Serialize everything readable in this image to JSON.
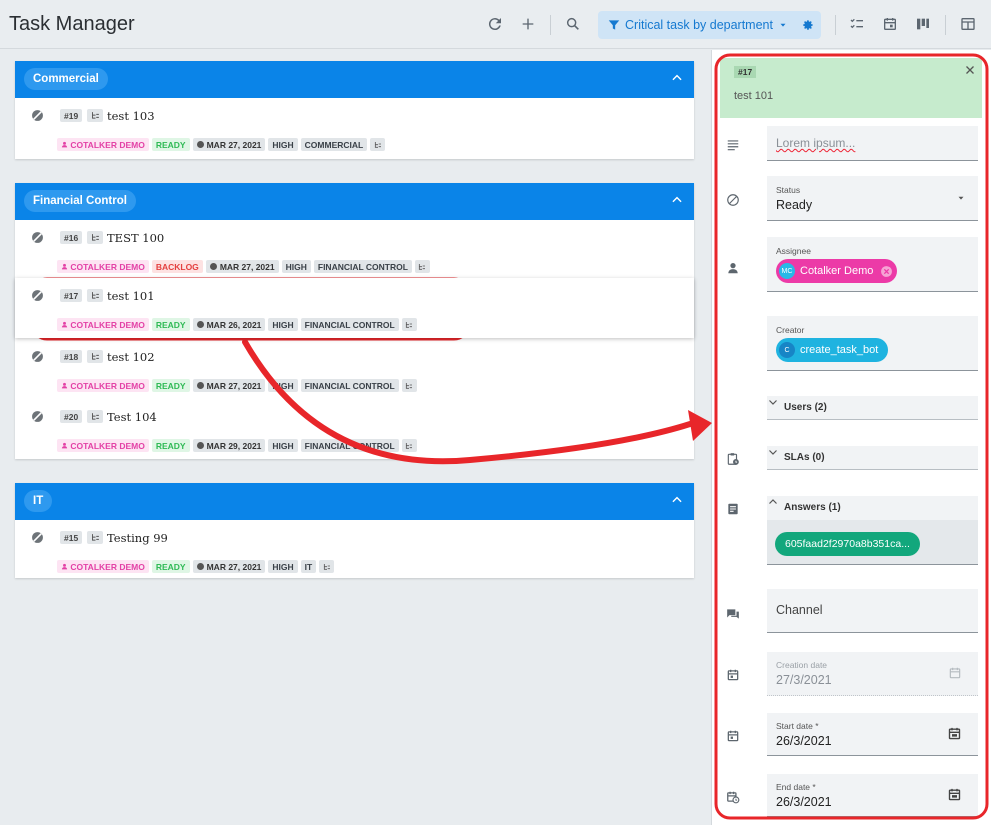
{
  "header": {
    "title": "Task Manager",
    "filter_label": "Critical task by department"
  },
  "groups": [
    {
      "name": "Commercial",
      "tasks": [
        {
          "id": "#19",
          "title": "test 103",
          "user": "COTALKER DEMO",
          "status": "READY",
          "date": "MAR 27, 2021",
          "priority": "HIGH",
          "dept": "COMMERCIAL"
        }
      ]
    },
    {
      "name": "Financial Control",
      "tasks": [
        {
          "id": "#16",
          "title": "TEST 100",
          "user": "COTALKER DEMO",
          "status": "BACKLOG",
          "date": "MAR 27, 2021",
          "priority": "HIGH",
          "dept": "FINANCIAL CONTROL"
        },
        {
          "id": "#17",
          "title": "test 101",
          "user": "COTALKER DEMO",
          "status": "READY",
          "date": "MAR 26, 2021",
          "priority": "HIGH",
          "dept": "FINANCIAL CONTROL"
        },
        {
          "id": "#18",
          "title": "test 102",
          "user": "COTALKER DEMO",
          "status": "READY",
          "date": "MAR 27, 2021",
          "priority": "HIGH",
          "dept": "FINANCIAL CONTROL"
        },
        {
          "id": "#20",
          "title": "Test 104",
          "user": "COTALKER DEMO",
          "status": "READY",
          "date": "MAR 29, 2021",
          "priority": "HIGH",
          "dept": "FINANCIAL CONTROL"
        }
      ]
    },
    {
      "name": "IT",
      "tasks": [
        {
          "id": "#15",
          "title": "Testing 99",
          "user": "COTALKER DEMO",
          "status": "READY",
          "date": "MAR 27, 2021",
          "priority": "HIGH",
          "dept": "IT"
        }
      ]
    }
  ],
  "detail": {
    "id": "#17",
    "title": "test 101",
    "description_placeholder": "Lorem ipsum...",
    "status_label": "Status",
    "status_value": "Ready",
    "assignee_label": "Assignee",
    "assignee_name": "Cotalker Demo",
    "assignee_initials": "MC",
    "creator_label": "Creator",
    "creator_name": "create_task_bot",
    "creator_initials": "C",
    "users_label": "Users (2)",
    "slas_label": "SLAs (0)",
    "answers_label": "Answers (1)",
    "answer_chip": "605faad2f2970a8b351ca...",
    "channel_label": "Channel",
    "creation_date_label": "Creation date",
    "creation_date_value": "27/3/2021",
    "start_date_label": "Start date *",
    "start_date_value": "26/3/2021",
    "end_date_label": "End date *",
    "end_date_value": "26/3/2021"
  },
  "colors": {
    "brand_blue": "#0a84e8",
    "annotation_red": "#e8262a",
    "detail_header_green": "#c6ebcd",
    "ready_green": "#2fba55",
    "backlog_red": "#e4403f",
    "user_pink": "#e341a6"
  }
}
